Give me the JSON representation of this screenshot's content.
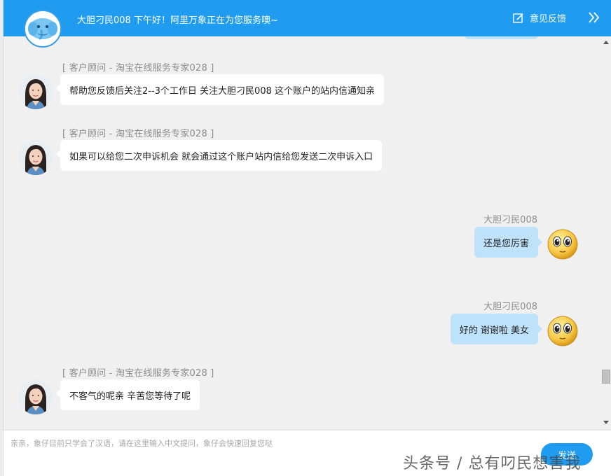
{
  "header": {
    "greeting": "大胆刁民008  下午好！阿里万象正在为您服务噢~",
    "feedback_label": "意见反馈"
  },
  "messages": [
    {
      "sender": "[ 客户顾问  -  淘宝在线服务专家028 ]",
      "text": "帮助您反馈后关注2--3个工作日   关注大胆刁民008    这个账户的站内信通知亲"
    },
    {
      "sender": "[ 客户顾问  -  淘宝在线服务专家028 ]",
      "text": "如果可以给您二次申诉机会 就会通过这个账户站内信给您发送二次申诉入口"
    },
    {
      "sender": "大胆刁民008",
      "text": "还是您厉害"
    },
    {
      "sender": "大胆刁民008",
      "text": "好的 谢谢啦 美女"
    },
    {
      "sender": "[ 客户顾问  -  淘宝在线服务专家028 ]",
      "text": "不客气的呢亲 辛苦您等待了呢"
    }
  ],
  "input": {
    "placeholder": "亲亲，象仔目前只学会了汉语，请在这里输入中文提问，象仔会快速回复您哒",
    "send_label": "发送"
  },
  "watermark": "头条号 / 总有叼民想害我",
  "colors": {
    "header_bg": "#1f9bf0",
    "chat_bg": "#f0f0f0",
    "user_bubble": "#bfe2fb",
    "agent_bubble": "#ffffff"
  }
}
